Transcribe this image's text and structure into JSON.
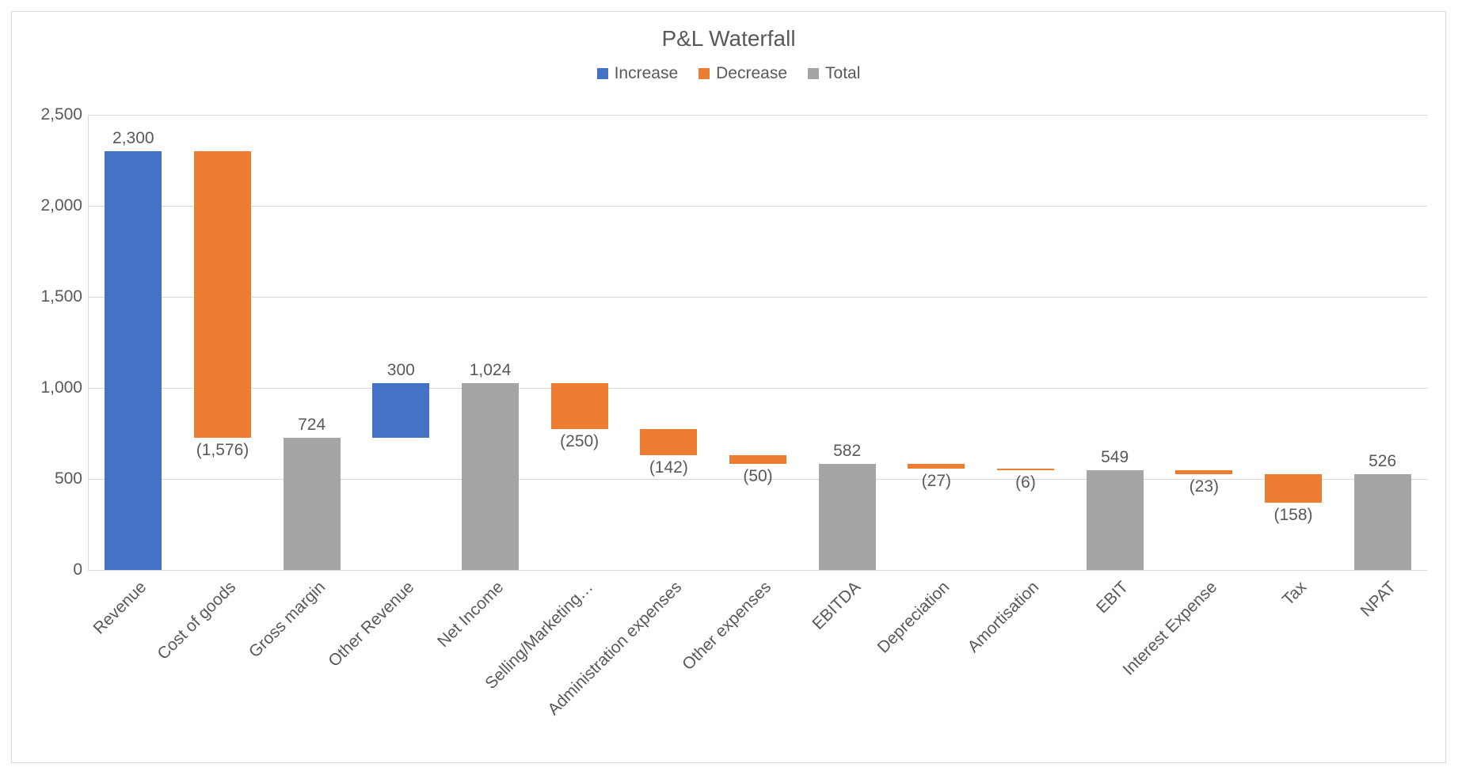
{
  "chart_data": {
    "type": "waterfall",
    "title": "P&L Waterfall",
    "ylabel": "",
    "xlabel": "",
    "ylim": [
      0,
      2500
    ],
    "ytick_step": 500,
    "legend": [
      {
        "name": "Increase",
        "color": "#4472c4"
      },
      {
        "name": "Decrease",
        "color": "#ed7d31"
      },
      {
        "name": "Total",
        "color": "#a5a5a5"
      }
    ],
    "categories": [
      "Revenue",
      "Cost of goods",
      "Gross margin",
      "Other Revenue",
      "Net Income",
      "Selling/Marketing…",
      "Administration expenses",
      "Other expenses",
      "EBITDA",
      "Depreciation",
      "Amortisation",
      "EBIT",
      "Interest Expense",
      "Tax",
      "NPAT"
    ],
    "bars": [
      {
        "kind": "increase",
        "value": 2300,
        "label": "2,300"
      },
      {
        "kind": "decrease",
        "value": -1576,
        "label": "(1,576)"
      },
      {
        "kind": "total",
        "value": 724,
        "label": "724"
      },
      {
        "kind": "increase",
        "value": 300,
        "label": "300"
      },
      {
        "kind": "total",
        "value": 1024,
        "label": "1,024"
      },
      {
        "kind": "decrease",
        "value": -250,
        "label": "(250)"
      },
      {
        "kind": "decrease",
        "value": -142,
        "label": "(142)"
      },
      {
        "kind": "decrease",
        "value": -50,
        "label": "(50)"
      },
      {
        "kind": "total",
        "value": 582,
        "label": "582"
      },
      {
        "kind": "decrease",
        "value": -27,
        "label": "(27)"
      },
      {
        "kind": "decrease",
        "value": -6,
        "label": "(6)"
      },
      {
        "kind": "total",
        "value": 549,
        "label": "549"
      },
      {
        "kind": "decrease",
        "value": -23,
        "label": "(23)"
      },
      {
        "kind": "decrease",
        "value": -158,
        "label": "(158)"
      },
      {
        "kind": "total",
        "value": 526,
        "label": "526"
      }
    ]
  }
}
